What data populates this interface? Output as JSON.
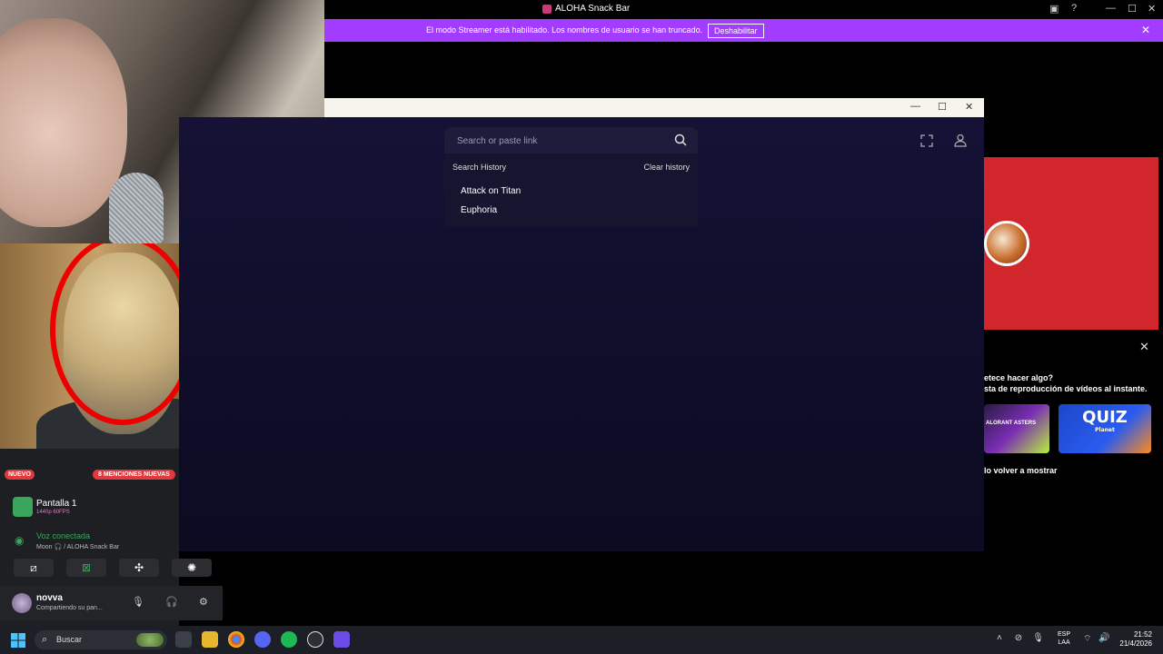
{
  "window": {
    "title": "ALOHA Snack Bar",
    "controls": {
      "minimize": "—",
      "maximize": "☐",
      "close": "✕"
    }
  },
  "streamer_banner": {
    "message": "El modo Streamer está habilitado. Los nombres de usuario se han truncado.",
    "button": "Deshabilitar"
  },
  "search": {
    "placeholder": "Search or paste link",
    "history_label": "Search History",
    "clear_label": "Clear history",
    "history": [
      "Attack on Titan",
      "Euphoria"
    ]
  },
  "right_panel": {
    "prompt_line1": "etece hacer algo?",
    "prompt_line2": "sta de reproducción de vídeos al instante.",
    "dismiss": "lo volver a mostrar",
    "cards": [
      {
        "title": "ALORANT ASTERS"
      },
      {
        "title": "QUIZ",
        "subtitle": "Planet"
      }
    ]
  },
  "discord": {
    "new_badge": "NUEVO",
    "mentions_badge": "8 MENCIONES NUEVAS",
    "screen_share": {
      "title": "Pantalla 1",
      "quality": "1440p 60FPS"
    },
    "voice": {
      "status": "Voz conectada",
      "channel": "Moon 🎧 / ALOHA Snack Bar"
    },
    "user": {
      "name": "novva",
      "status": "Compartiendo su pan..."
    }
  },
  "taskbar": {
    "search_label": "Buscar",
    "language": "ESP",
    "language_sub": "LAA",
    "time": "21:52",
    "date": "21/4/2026"
  }
}
